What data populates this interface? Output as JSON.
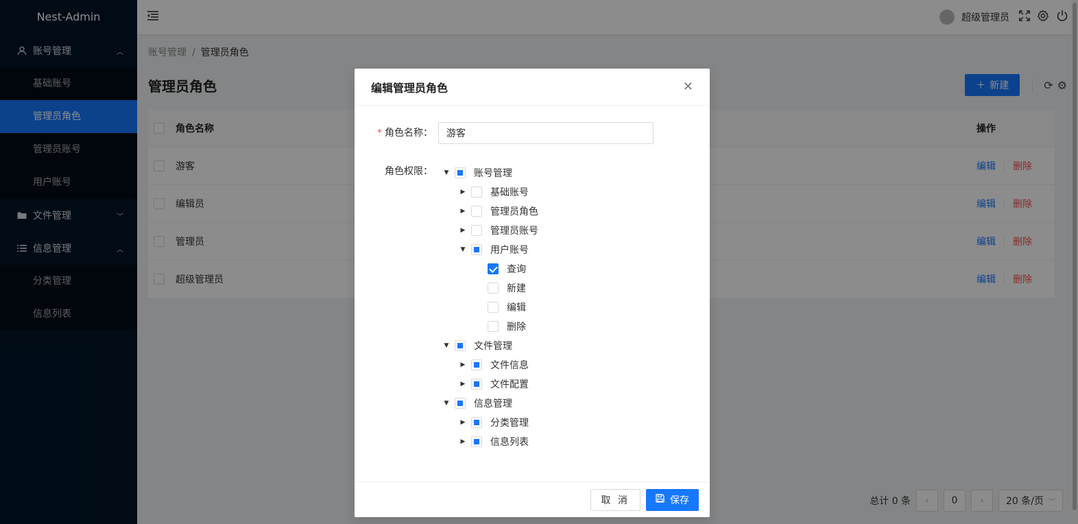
{
  "sidebar": {
    "logo": "Nest-Admin",
    "groups": [
      {
        "label": "账号管理",
        "icon": "user-icon",
        "expanded": true,
        "items": [
          {
            "label": "基础账号"
          },
          {
            "label": "管理员角色",
            "active": true
          },
          {
            "label": "管理员账号"
          },
          {
            "label": "用户账号"
          }
        ]
      },
      {
        "label": "文件管理",
        "icon": "folder-icon",
        "expanded": false,
        "items": []
      },
      {
        "label": "信息管理",
        "icon": "list-icon",
        "expanded": true,
        "items": [
          {
            "label": "分类管理"
          },
          {
            "label": "信息列表"
          }
        ]
      }
    ]
  },
  "header": {
    "user_name": "超级管理员"
  },
  "breadcrumb": {
    "parent": "账号管理",
    "sep": "/",
    "current": "管理员角色"
  },
  "page": {
    "title": "管理员角色",
    "new_label": "新建",
    "columns": {
      "name": "角色名称",
      "op": "操作"
    },
    "rows": [
      {
        "name": "游客"
      },
      {
        "name": "编辑员"
      },
      {
        "name": "管理员"
      },
      {
        "name": "超级管理员"
      }
    ],
    "edit_label": "编辑",
    "delete_label": "删除",
    "total_label": "总计 0 条",
    "page_num": "0",
    "page_size": "20 条/页"
  },
  "modal": {
    "title": "编辑管理员角色",
    "name_label": "角色名称",
    "name_value": "游客",
    "perm_label": "角色权限",
    "cancel_label": "取 消",
    "save_label": "保存"
  },
  "colors": {
    "primary": "#1677ff",
    "danger": "#ff4d4f",
    "sidebar_bg": "#001529"
  }
}
